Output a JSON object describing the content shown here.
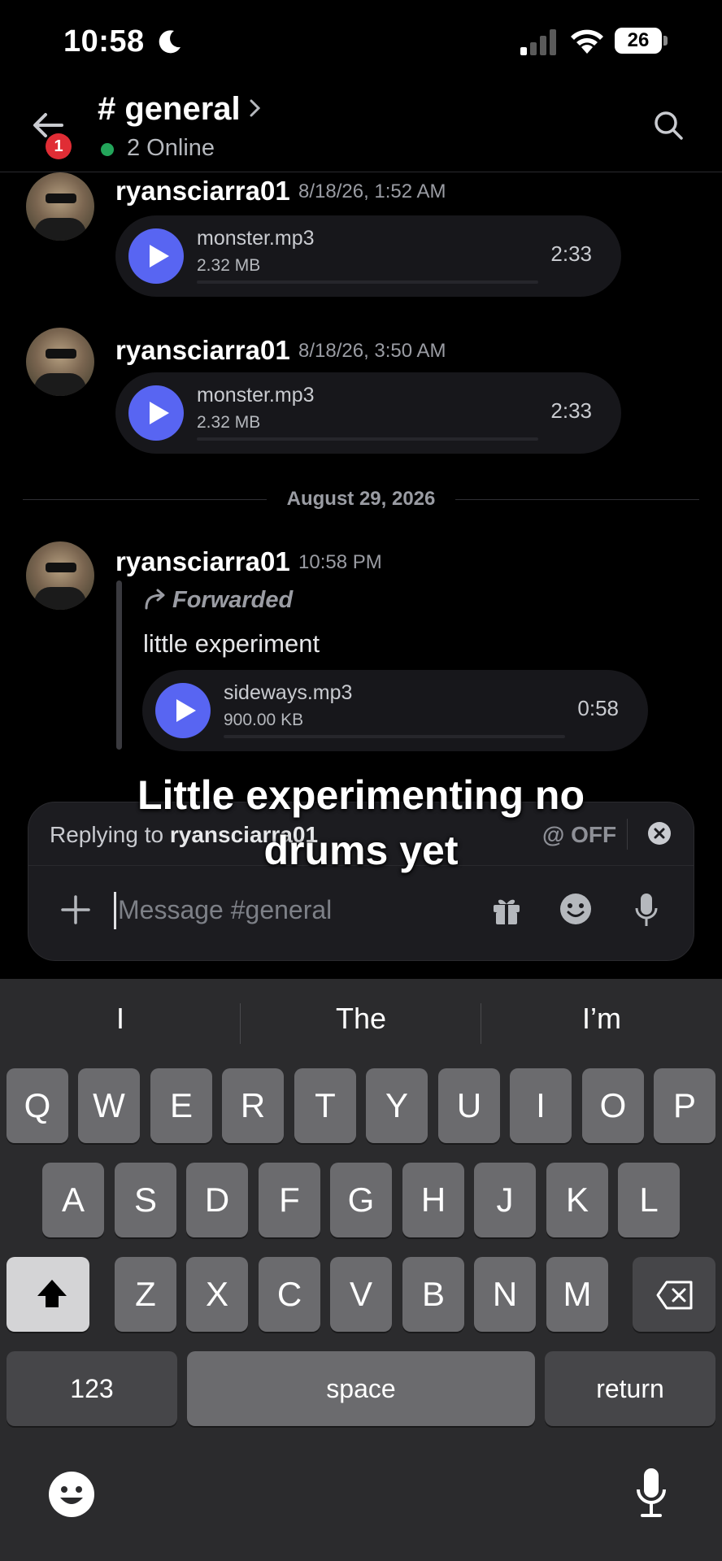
{
  "status_bar": {
    "time": "10:58",
    "battery": "26"
  },
  "header": {
    "notification_count": "1",
    "channel_name": "# general",
    "online": "2 Online"
  },
  "messages": [
    {
      "username": "ryansciarra01",
      "timestamp": "8/18/26, 1:52 AM",
      "attachment": {
        "name": "monster.mp3",
        "size": "2.32 MB",
        "duration": "2:33"
      }
    },
    {
      "username": "ryansciarra01",
      "timestamp": "8/18/26, 3:50 AM",
      "attachment": {
        "name": "monster.mp3",
        "size": "2.32 MB",
        "duration": "2:33"
      }
    },
    {
      "username": "ryansciarra01",
      "timestamp": "10:58 PM",
      "forwarded_label": "Forwarded",
      "text": "little experiment",
      "attachment": {
        "name": "sideways.mp3",
        "size": "900.00 KB",
        "duration": "0:58"
      }
    }
  ],
  "date_divider": "August 29, 2026",
  "composer": {
    "reply_prefix": "Replying to ",
    "reply_user": "ryansciarra01",
    "mention_toggle": "@ OFF",
    "placeholder": "Message #general"
  },
  "caption": {
    "line1": "Little experimenting no",
    "line2": "drums yet"
  },
  "keyboard": {
    "suggestions": [
      "I",
      "The",
      "I’m"
    ],
    "row1": [
      "Q",
      "W",
      "E",
      "R",
      "T",
      "Y",
      "U",
      "I",
      "O",
      "P"
    ],
    "row2": [
      "A",
      "S",
      "D",
      "F",
      "G",
      "H",
      "J",
      "K",
      "L"
    ],
    "row3": [
      "Z",
      "X",
      "C",
      "V",
      "B",
      "N",
      "M"
    ],
    "numbers_key": "123",
    "space_key": "space",
    "return_key": "return"
  },
  "colors": {
    "accent": "#5865f2",
    "online": "#23a55a",
    "badge": "#e02d35"
  }
}
